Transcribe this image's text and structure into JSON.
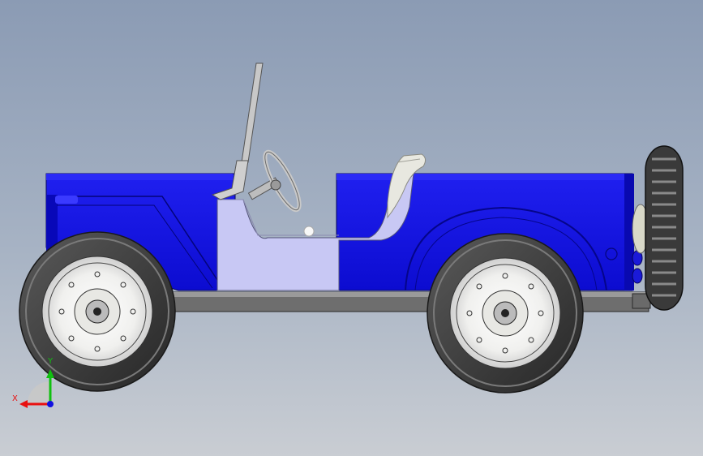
{
  "viewport": {
    "background_top": "#8b9bb4",
    "background_bottom": "#c9cdd3"
  },
  "model": {
    "body_color": "#1212e6",
    "body_dark": "#0a0aa8",
    "interior_color": "#c8c8f4",
    "chassis_color": "#707070",
    "tire_color": "#333333",
    "rim_color": "#f4f4f4",
    "seat_color": "#e8e8e0"
  },
  "triad": {
    "x_label": "X",
    "y_label": "Y",
    "x_color": "#e81010",
    "y_color": "#10c010",
    "z_color": "#1010e0",
    "icons": [
      "axis-triad-icon"
    ]
  }
}
